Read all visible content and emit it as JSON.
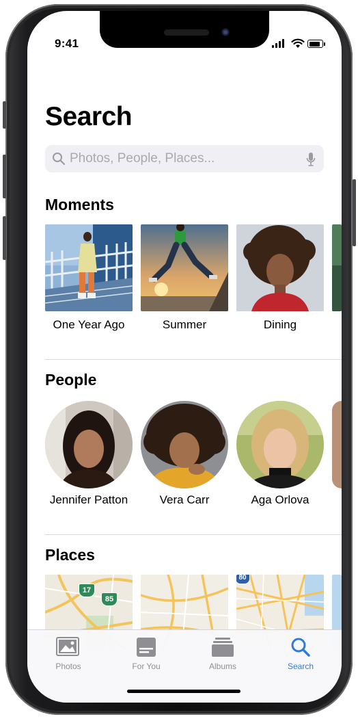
{
  "status_bar": {
    "time": "9:41"
  },
  "header": {
    "title": "Search"
  },
  "search": {
    "placeholder": "Photos, People, Places..."
  },
  "moments": {
    "title": "Moments",
    "items": [
      {
        "label": "One Year Ago"
      },
      {
        "label": "Summer"
      },
      {
        "label": "Dining"
      }
    ]
  },
  "people": {
    "title": "People",
    "items": [
      {
        "name": "Jennifer Patton"
      },
      {
        "name": "Vera Carr"
      },
      {
        "name": "Aga Orlova"
      }
    ]
  },
  "places": {
    "title": "Places",
    "map_badges": [
      "17",
      "85",
      "80"
    ]
  },
  "tabbar": {
    "tabs": [
      {
        "label": "Photos",
        "icon": "photos-icon"
      },
      {
        "label": "For You",
        "icon": "for-you-icon"
      },
      {
        "label": "Albums",
        "icon": "albums-icon"
      },
      {
        "label": "Search",
        "icon": "search-icon",
        "active": true
      }
    ]
  },
  "colors": {
    "accent": "#2f7bd8",
    "inactive": "#8e8e93",
    "search_bg": "#efeff4"
  }
}
